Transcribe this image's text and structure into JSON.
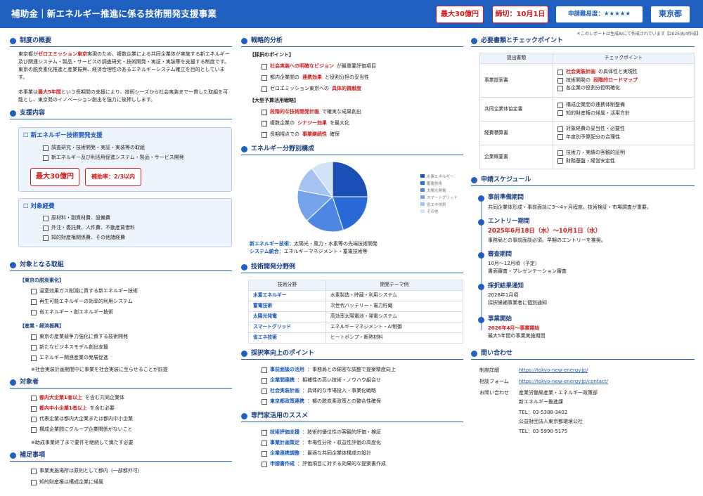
{
  "header": {
    "title": "補助金｜新エネルギー推進に係る技術開発支援事業",
    "amount": "最大30億円",
    "deadline": "締切：10月1日",
    "difficulty": "申請難易度：★★★★★",
    "region": "東京都"
  },
  "note": "＊このレポートは生成AIにて作成されています【2025/8/4作成】",
  "overview": {
    "title": "制度の概要",
    "p1_pre": "東京都が",
    "p1_red": "ゼロエミッション東京",
    "p1_post": "実現のため、複数企業による共同企業体が実施する新エネルギー及び関連システム・製品・サービスの調査研究・技術開発・実証・実装等を支援する制度です。東京の脱炭素化推進と産業振興、経済合理性のあるエネルギーシステム確立を目的としています。",
    "p2_pre": "本事業は",
    "p2_red": "最大5年間",
    "p2_post": "という長期間の支援により、技術シーズから社会実装まで一貫した取組を可能とし、東京発のイノベーション創出を強力に後押しします。"
  },
  "support": {
    "title": "支援内容",
    "box1_title": "新エネルギー技術開発支援",
    "box1_items": [
      "調査研究・技術開発・実証・実装等の取組",
      "新エネルギー及び利活用促進システム・製品・サービス開発"
    ],
    "max": "最大30億円",
    "rate": "補助率：2/3以内",
    "box2_title": "対象経費",
    "box2_items": [
      "原材料・副資材費、設備費",
      "外注・委託費、人件費、不動産賃借料",
      "知的財産権関係費、その他諸経費"
    ]
  },
  "targets": {
    "title": "対象となる取組",
    "cat1": "【東京の脱炭素化】",
    "cat1_items": [
      "温室効果ガス削減に資する新エネルギー技術",
      "再生可能エネルギーの効率的利用システム",
      "省エネルギー・創エネルギー技術"
    ],
    "cat2": "【産業・経済振興】",
    "cat2_items": [
      "東京の産業競争力強化に資する技術開発",
      "新たなビジネスモデル創出支援",
      "エネルギー関連産業の発展促進"
    ],
    "note": "※社会実装計画期間中に事業を社会実装に至らせることが前提"
  },
  "eligible": {
    "title": "対象者",
    "items_red": [
      "都内大企業1者以上",
      "都内中小企業1者以上"
    ],
    "items_red_suffix": [
      "を含む共同企業体",
      "を含む必要"
    ],
    "items": [
      "代表企業は都内大企業または都内中小企業",
      "構成企業間にグループ企業関係がないこと"
    ],
    "note": "※助成事業終了まで要件を継続して満たす必要"
  },
  "supplement": {
    "title": "補足事項",
    "items": [
      "事業実施場所は原則として都内（一部都外可）",
      "知的財産権は構成企業に帰属"
    ]
  },
  "strategy": {
    "title": "戦略的分析",
    "g1": "【採択のポイント】",
    "g1_items": [
      {
        "red": "社会実装への明確なビジョン",
        "rest": "が最重要評価項目"
      },
      {
        "pre": "都内企業間の",
        "red": "連携効果",
        "rest": "と役割分担の妥当性"
      },
      {
        "pre": "ゼロエミッション東京への",
        "red": "具体的貢献度",
        "rest": ""
      }
    ],
    "g2": "【大型予算活用戦略】",
    "g2_items": [
      {
        "red": "段階的な技術開発計画",
        "rest": "で確実な成果創出"
      },
      {
        "pre": "複数企業の",
        "red": "シナジー効果",
        "rest": "を最大化"
      },
      {
        "pre": "長期視点での",
        "red": "事業継続性",
        "rest": "確保"
      }
    ]
  },
  "pie": {
    "title": "エネルギー分野別構成",
    "caption1_b": "新エネルギー技術",
    "caption1": "：太陽光・風力・水素等の先端技術開発",
    "caption2_b": "システム統合",
    "caption2": "：エネルギーマネジメント・蓄電技術等"
  },
  "chart_data": {
    "type": "pie",
    "categories": [
      "水素エネルギー",
      "蓄電技術",
      "太陽光発電",
      "スマートグリッド",
      "省エネ技術",
      "その他"
    ],
    "values": [
      25,
      20,
      18,
      15,
      12,
      10
    ],
    "colors": [
      "#1b4fb5",
      "#2a6ad8",
      "#4d86e3",
      "#76a4ec",
      "#a4c3f3",
      "#d2e2f9"
    ],
    "legend_position": "right"
  },
  "tech": {
    "title": "技術開発分野例",
    "headers": [
      "技術分野",
      "開発テーマ例"
    ],
    "rows": [
      [
        "水素エネルギー",
        "水素製造・貯蔵・利用システム"
      ],
      [
        "蓄電技術",
        "次世代バッテリー・電力貯蔵"
      ],
      [
        "太陽光発電",
        "高効率太陽電池・発電システム"
      ],
      [
        "スマートグリッド",
        "エネルギーマネジメント・AI制御"
      ],
      [
        "省エネ技術",
        "ヒートポンプ・断熱材料"
      ]
    ]
  },
  "improve": {
    "title": "採択率向上のポイント",
    "items": [
      [
        "事前面談の活用",
        "：事務局との綿密な調整で提案精度向上"
      ],
      [
        "企業間連携",
        "：相補性の高い技術・ノウハウ組合せ"
      ],
      [
        "社会実装計画",
        "：具体的な市場投入・事業化戦略"
      ],
      [
        "東京都政策連携",
        "：都の脱炭素政策との整合性確保"
      ]
    ]
  },
  "expert": {
    "title": "専門家活用のススメ",
    "items": [
      [
        "技術評価支援",
        "：技術的優位性の客観的評価・検証"
      ],
      [
        "事業計画策定",
        "：市場性分析・収益性評価の高度化"
      ],
      [
        "企業連携調整",
        "：最適な共同企業体構成の設計"
      ],
      [
        "申請書作成",
        "：評価項目に対する効果的な提案書作成"
      ]
    ]
  },
  "docs": {
    "title": "必要書類とチェックポイント",
    "headers": [
      "提出書類",
      "チェックポイント"
    ],
    "rows": [
      {
        "doc": "事業提案書",
        "items": [
          {
            "red": "社会実装計画",
            "rest": "の具体性と実現性"
          },
          {
            "pre": "技術開発の",
            "red": "段階的ロードマップ",
            "rest": ""
          },
          {
            "rest": "各企業の役割分担明確化"
          }
        ]
      },
      {
        "doc": "共同企業体協定書",
        "items": [
          {
            "rest": "構成企業間の連携体制整備"
          },
          {
            "rest": "知的財産権の帰属・活用方針"
          }
        ]
      },
      {
        "doc": "経費積算書",
        "items": [
          {
            "rest": "対象経費の妥当性・必要性"
          },
          {
            "rest": "年度別予算配分の合理性"
          }
        ]
      },
      {
        "doc": "企業概要書",
        "items": [
          {
            "rest": "技術力・実績の客観的証明"
          },
          {
            "rest": "財務基盤・経営安定性"
          }
        ]
      }
    ]
  },
  "schedule": {
    "title": "申請スケジュール",
    "steps": [
      {
        "t": "事前準備期間",
        "l1": "共同企業体形成・事前面談に3〜4ヶ月程度。技術検証・市場調査が重要。",
        "l2": ""
      },
      {
        "t": "エントリー期間",
        "l1": "2025年6月18日（水）〜10月1日（水）",
        "l2": "事務局との事前面談必須。早期のエントリーを推奨。"
      },
      {
        "t": "審査期間",
        "l1": "10月〜12月頃（予定）",
        "l2": "書面審査・プレゼンテーション審査"
      },
      {
        "t": "採択結果通知",
        "l1": "2026年1月頃",
        "l2": "採択候補事業者に個別通知"
      },
      {
        "t": "事業開始",
        "l1": "2026年4月〜事業開始",
        "l2": "最大5年間の事業実施期間"
      }
    ]
  },
  "contact": {
    "title": "問い合わせ",
    "rows": [
      [
        "制度詳細",
        "https://tokyo-new-energy.jp/"
      ],
      [
        "相談フォーム",
        "https://tokyo-new-energy.jp/contact/"
      ]
    ],
    "inq_label": "お問い合わせ",
    "inq_lines": [
      "産業労働局産業・エネルギー政策部",
      "新エネルギー推進課",
      "TEL：03-5388-3402",
      "公益財団法人東京都環境公社",
      "TEL：03-5990-5175"
    ]
  }
}
